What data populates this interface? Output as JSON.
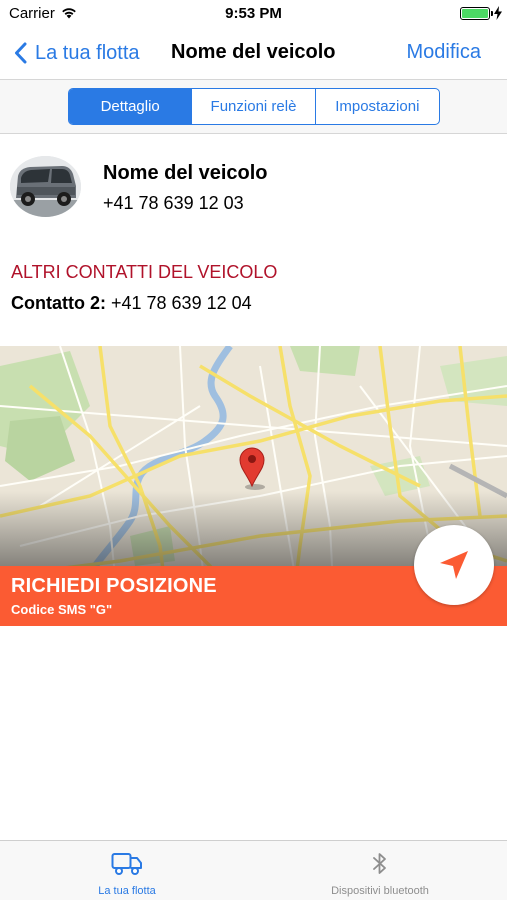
{
  "status_bar": {
    "carrier": "Carrier",
    "time": "9:53 PM",
    "wifi_icon": "wifi-icon",
    "battery_icon": "battery-icon",
    "battery_color": "#4cd964",
    "charging_icon": "bolt-icon"
  },
  "nav": {
    "back_label": "La tua flotta",
    "title": "Nome del veicolo",
    "edit_label": "Modifica",
    "accent_color": "#2a7ae4"
  },
  "segments": {
    "items": [
      {
        "label": "Dettaglio",
        "selected": true
      },
      {
        "label": "Funzioni relè",
        "selected": false
      },
      {
        "label": "Impostazioni",
        "selected": false
      }
    ]
  },
  "vehicle": {
    "photo_icon": "van-photo",
    "name": "Nome del veicolo",
    "phone": "+41 78 639 12 03"
  },
  "contacts": {
    "heading": "ALTRI CONTATTI DEL VEICOLO",
    "heading_color": "#b0122a",
    "label": "Contatto 2:",
    "value": " +41 78 639 12 04"
  },
  "map": {
    "pin_icon": "map-pin-icon",
    "request_title": "RICHIEDI POSIZIONE",
    "request_subtitle": "Codice SMS \"G\"",
    "banner_color": "#fb5b33",
    "locate_icon": "location-arrow-icon"
  },
  "tab_bar": {
    "items": [
      {
        "label": "La tua flotta",
        "icon": "truck-icon",
        "selected": true
      },
      {
        "label": "Dispositivi bluetooth",
        "icon": "bluetooth-icon",
        "selected": false
      }
    ]
  }
}
